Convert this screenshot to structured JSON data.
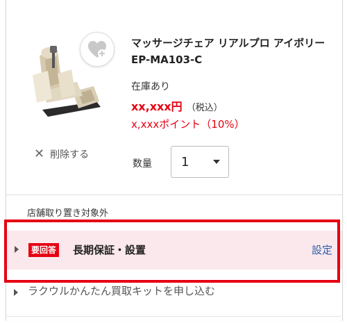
{
  "product": {
    "title": "マッサージチェア リアルプロ アイボリー EP-MA103-C",
    "stock": "在庫あり",
    "price": "xx,xxx円",
    "tax_note": "（税込）",
    "points": "x,xxxポイント（10%）"
  },
  "actions": {
    "delete_label": "削除する",
    "favorite_icon": "heart-plus-icon"
  },
  "quantity": {
    "label": "数量",
    "value": "1"
  },
  "pickup_note": "店舗取り置き対象外",
  "warranty": {
    "badge": "要回答",
    "title": "長期保証・設置",
    "link": "設定"
  },
  "buyback": {
    "label": "ラクウルかんたん買取キットを申し込む"
  },
  "colors": {
    "accent_red": "#e60012",
    "link_blue": "#2a5caa",
    "warranty_bg": "#fbe8ec"
  }
}
